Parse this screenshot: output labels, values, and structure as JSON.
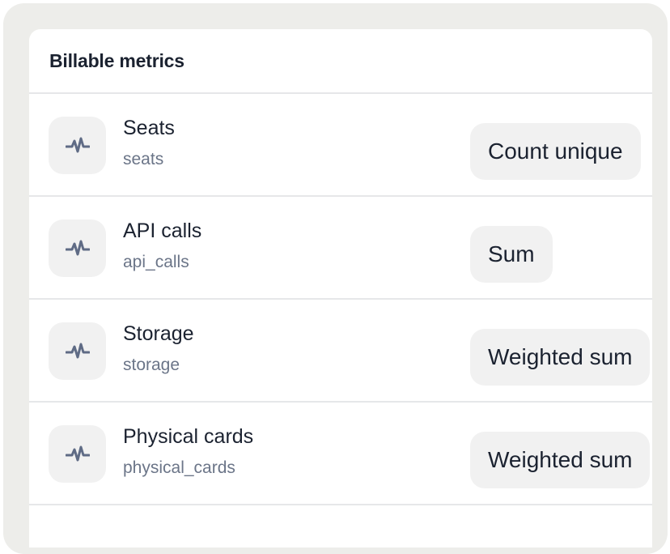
{
  "card": {
    "title": "Billable metrics"
  },
  "metrics": [
    {
      "name": "Seats",
      "code": "seats",
      "aggregation": "Count unique",
      "icon": "pulse-icon"
    },
    {
      "name": "API calls",
      "code": "api_calls",
      "aggregation": "Sum",
      "icon": "pulse-icon"
    },
    {
      "name": "Storage",
      "code": "storage",
      "aggregation": "Weighted sum",
      "icon": "pulse-icon"
    },
    {
      "name": "Physical cards",
      "code": "physical_cards",
      "aggregation": "Weighted sum",
      "icon": "pulse-icon"
    }
  ],
  "colors": {
    "frame": "#ededea",
    "card": "#ffffff",
    "text": "#1b2230",
    "muted_text": "#6b7588",
    "icon": "#5f6b85",
    "pill": "#f1f1f1",
    "divider": "#e6e7e9"
  }
}
